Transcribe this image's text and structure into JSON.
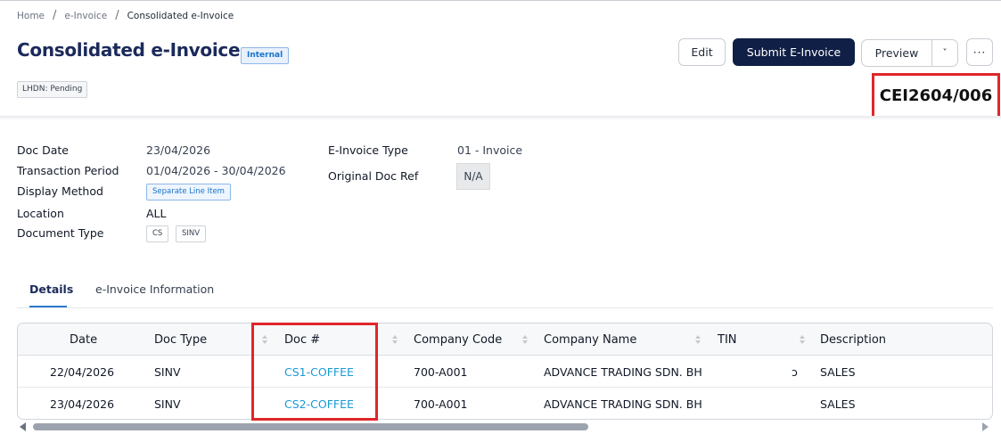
{
  "breadcrumb": {
    "items": [
      "Home",
      "e-Invoice",
      "Consolidated e-Invoice"
    ],
    "separator": "/"
  },
  "header": {
    "title": "Consolidated e-Invoice",
    "badge": "Internal",
    "status": "LHDN: Pending",
    "doc_number": "CEI2604/006"
  },
  "toolbar": {
    "edit_label": "Edit",
    "submit_label": "Submit E-Invoice",
    "preview_label": "Preview",
    "caret_label": "˅",
    "more_label": "···"
  },
  "details_left": {
    "doc_date": {
      "label": "Doc Date",
      "value": "23/04/2026"
    },
    "transaction_period": {
      "label": "Transaction Period",
      "value": "01/04/2026 - 30/04/2026"
    },
    "display_method": {
      "label": "Display Method",
      "value": "Separate Line Item"
    },
    "location": {
      "label": "Location",
      "value": "ALL"
    },
    "document_type": {
      "label": "Document Type",
      "values": [
        "CS",
        "SINV"
      ]
    }
  },
  "details_right": {
    "einvoice_type": {
      "label": "E-Invoice Type",
      "value": "01 - Invoice"
    },
    "original_doc_ref": {
      "label": "Original Doc Ref",
      "value": "N/A"
    }
  },
  "tabs": [
    {
      "label": "Details",
      "active": true
    },
    {
      "label": "e-Invoice Information",
      "active": false
    }
  ],
  "table": {
    "columns": [
      "Date",
      "Doc Type",
      "Doc #",
      "Company Code",
      "Company Name",
      "TIN",
      "Description"
    ],
    "rows": [
      {
        "date": "22/04/2026",
        "doc_type": "SINV",
        "doc_no": "CS1-COFFEE",
        "company_code": "700-A001",
        "company_name": "ADVANCE TRADING SDN. BH...",
        "tin": "ɔ",
        "description": "SALES"
      },
      {
        "date": "23/04/2026",
        "doc_type": "SINV",
        "doc_no": "CS2-COFFEE",
        "company_code": "700-A001",
        "company_name": "ADVANCE TRADING SDN. BH...",
        "tin": "",
        "description": "SALES"
      }
    ]
  },
  "colors": {
    "brand_navy": "#0f1f45",
    "title_navy": "#1b2a5b",
    "link_blue": "#1a9ad6",
    "highlight_red": "#e0262a"
  }
}
